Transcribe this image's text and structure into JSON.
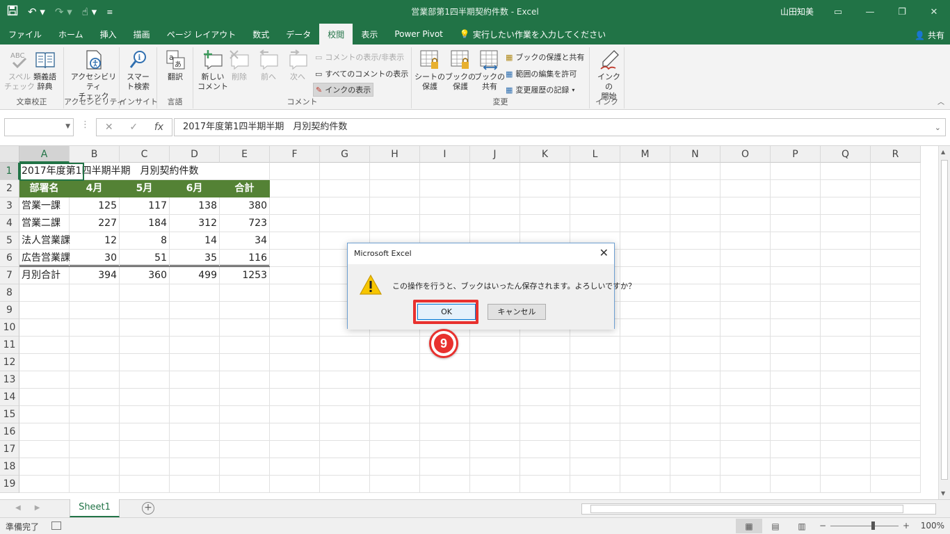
{
  "titlebar": {
    "title": "営業部第1四半期契約件数 - Excel",
    "user": "山田知美",
    "qat_icons": [
      "save-icon",
      "undo-icon",
      "redo-icon",
      "touch-mode-icon",
      "customize-icon"
    ]
  },
  "ribbon_tabs": {
    "items": [
      "ファイル",
      "ホーム",
      "挿入",
      "描画",
      "ページ レイアウト",
      "数式",
      "データ",
      "校閲",
      "表示",
      "Power Pivot"
    ],
    "active": "校閲",
    "tell_me": "実行したい作業を入力してください",
    "share": "共有"
  },
  "ribbon": {
    "groups": {
      "proofing": "文章校正",
      "accessibility": "アクセシビリティ",
      "insights": "インサイト",
      "language": "言語",
      "comments": "コメント",
      "changes": "変更",
      "ink": "インク"
    },
    "spell": [
      "スペル",
      "チェック"
    ],
    "thesaurus": [
      "類義語",
      "辞典"
    ],
    "check_access": [
      "アクセシビリティ",
      "チェック"
    ],
    "smart": [
      "スマー",
      "ト検索"
    ],
    "translate": "翻訳",
    "new_comment": [
      "新しい",
      "コメント"
    ],
    "delete": "削除",
    "prev": "前へ",
    "next": "次へ",
    "show_hide_comment": "コメントの表示/非表示",
    "show_all_comments": "すべてのコメントの表示",
    "show_ink": "インクの表示",
    "protect_sheet": [
      "シートの",
      "保護"
    ],
    "protect_book": [
      "ブックの",
      "保護"
    ],
    "share_book": [
      "ブックの",
      "共有"
    ],
    "protect_share": "ブックの保護と共有",
    "allow_edit": "範囲の編集を許可",
    "track_changes": "変更履歴の記録",
    "start_ink": [
      "インクの",
      "開始"
    ]
  },
  "formula_bar": {
    "name_box": "",
    "content": "2017年度第1四半期半期　月別契約件数"
  },
  "grid": {
    "columns": [
      "A",
      "B",
      "C",
      "D",
      "E",
      "F",
      "G",
      "H",
      "I",
      "J",
      "K",
      "L",
      "M",
      "N",
      "O",
      "P",
      "Q",
      "R"
    ],
    "rows": [
      [
        "2017年度第1四半期半期　月別契約件数",
        "",
        "",
        "",
        "",
        ""
      ],
      [
        "部署名",
        "4月",
        "5月",
        "6月",
        "合計",
        ""
      ],
      [
        "営業一課",
        "125",
        "117",
        "138",
        "380",
        ""
      ],
      [
        "営業二課",
        "227",
        "184",
        "312",
        "723",
        ""
      ],
      [
        "法人営業課",
        "12",
        "8",
        "14",
        "34",
        ""
      ],
      [
        "広告営業課",
        "30",
        "51",
        "35",
        "116",
        ""
      ],
      [
        "月別合計",
        "394",
        "360",
        "499",
        "1253",
        ""
      ]
    ],
    "row_numbers": [
      "1",
      "2",
      "3",
      "4",
      "5",
      "6",
      "7",
      "8",
      "9",
      "10",
      "11",
      "12",
      "13",
      "14",
      "15",
      "16",
      "17",
      "18",
      "19"
    ]
  },
  "sheet_tabs": {
    "active": "Sheet1"
  },
  "status": {
    "text": "準備完了",
    "zoom": "100%"
  },
  "dialog": {
    "title": "Microsoft Excel",
    "message": "この操作を行うと、ブックはいったん保存されます。よろしいですか？",
    "ok": "OK",
    "cancel": "キャンセル"
  },
  "annotation": {
    "step": "9",
    "color": "#e8312e"
  },
  "colors": {
    "excel_green": "#217346",
    "header_fill": "#548235"
  }
}
